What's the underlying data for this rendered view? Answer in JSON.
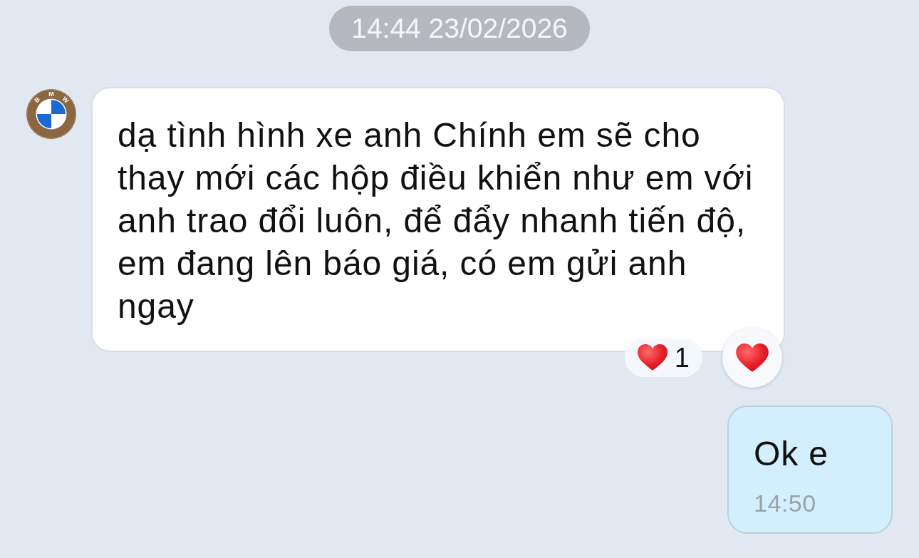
{
  "date_divider": "14:44 23/02/2026",
  "messages": [
    {
      "kind": "incoming",
      "avatar_letters": [
        "B",
        "M",
        "W"
      ],
      "text": "dạ tình hình xe anh Chính em sẽ cho thay mới các hộp điều khiển như em với anh trao đổi luôn, để đẩy nhanh tiến độ, em đang lên báo giá, có em gửi anh ngay",
      "reactions": [
        {
          "count": "1"
        }
      ]
    },
    {
      "kind": "outgoing",
      "text": "Ok e",
      "time": "14:50"
    }
  ]
}
